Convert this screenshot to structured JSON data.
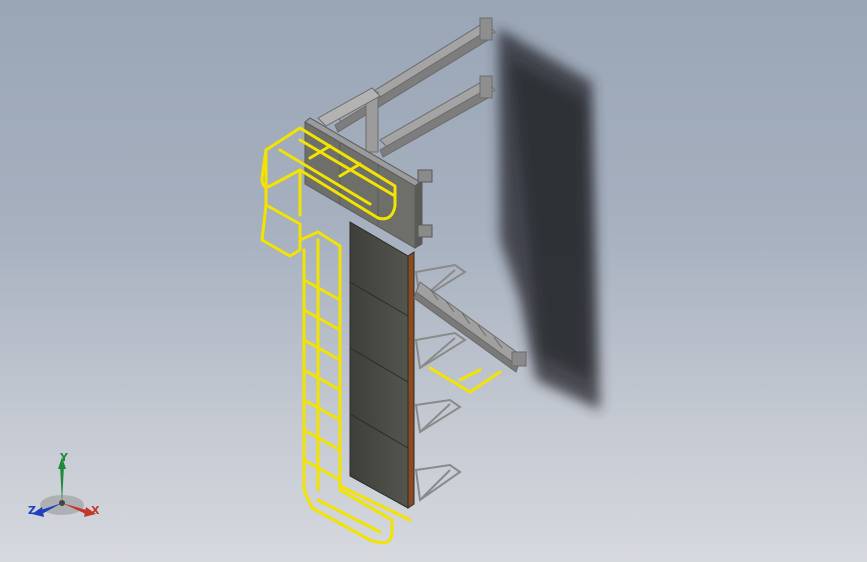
{
  "view": {
    "type": "3d-cad-model-viewport",
    "colors": {
      "background_top": "#9aa6b6",
      "background_bottom": "#d6d9de",
      "ladder": "#f2e400",
      "steel_frame": "#9a9a9a",
      "panel": "#4a4a46",
      "panel_edge_rust": "#8a4a22",
      "shadow": "#2a2c30"
    }
  },
  "triad": {
    "x_label": "X",
    "y_label": "Y",
    "z_label": "Z",
    "x_color": "#c0392b",
    "y_color": "#1e8a3a",
    "z_color": "#1f3fbf"
  }
}
